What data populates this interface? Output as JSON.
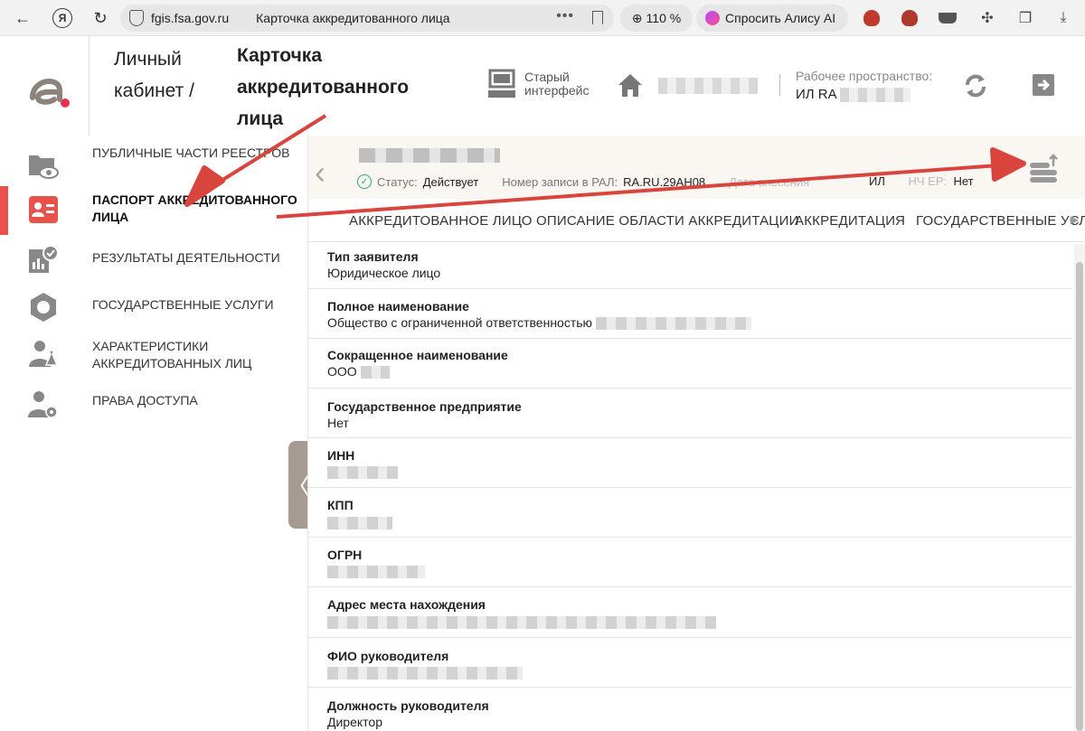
{
  "browser": {
    "back_label": "←",
    "ya_label": "Я",
    "reload_label": "↻",
    "domain": "fgis.fsa.gov.ru",
    "tab_title": "Карточка аккредитованного лица",
    "zoom": "110 %",
    "alice": "Спросить Алису AI"
  },
  "header": {
    "crumb1": "Личный кабинет /",
    "crumb2": "Карточка аккредитованного лица",
    "old_ui": "Старый интерфейс",
    "workspace_label": "Рабочее пространство:",
    "workspace_value": "ИЛ RA"
  },
  "sidebar": {
    "items": [
      {
        "label": "ПУБЛИЧНЫЕ ЧАСТИ РЕЕСТРОВ",
        "icon": "folder-eye-icon"
      },
      {
        "label": "ПАСПОРТ АККРЕДИТОВАННОГО ЛИЦА",
        "icon": "passport-icon"
      },
      {
        "label": "РЕЗУЛЬТАТЫ ДЕЯТЕЛЬНОСТИ",
        "icon": "chart-check-icon"
      },
      {
        "label": "ГОСУДАРСТВЕННЫЕ УСЛУГИ",
        "icon": "hexagon-icon"
      },
      {
        "label": "ХАРАКТЕРИСТИКИ АККРЕДИТОВАННЫХ ЛИЦ",
        "icon": "person-flask-icon"
      },
      {
        "label": "ПРАВА ДОСТУПА",
        "icon": "person-gear-icon"
      }
    ]
  },
  "card": {
    "status_label": "Статус:",
    "status_value": "Действует",
    "record_label": "Номер записи в РАЛ:",
    "record_value": "RA.RU.29АН08",
    "date_label": "Дата внесения",
    "extra_1": "ИЛ",
    "extra_2": "НЧ ЕР:",
    "extra_3": "Нет"
  },
  "tabs": [
    "АККРЕДИТОВАННОЕ ЛИЦО",
    "ОПИСАНИЕ ОБЛАСТИ АККРЕДИТАЦИИ",
    "АККРЕДИТАЦИЯ",
    "ГОСУДАРСТВЕННЫЕ УСЛ"
  ],
  "fields": [
    {
      "label": "Тип заявителя",
      "value": "Юридическое лицо"
    },
    {
      "label": "Полное наименование",
      "value": "Общество с ограниченной ответственностью"
    },
    {
      "label": "Сокращенное наименование",
      "value": "ООО"
    },
    {
      "label": "Государственное предприятие",
      "value": "Нет"
    },
    {
      "label": "ИНН",
      "value": ""
    },
    {
      "label": "КПП",
      "value": ""
    },
    {
      "label": "ОГРН",
      "value": ""
    },
    {
      "label": "Адрес места нахождения",
      "value": ""
    },
    {
      "label": "ФИО руководителя",
      "value": ""
    },
    {
      "label": "Должность руководителя",
      "value": "Директор"
    }
  ],
  "colors": {
    "accent": "#e8524d",
    "status_green": "#27a877",
    "header_bg": "#faf6f2"
  }
}
